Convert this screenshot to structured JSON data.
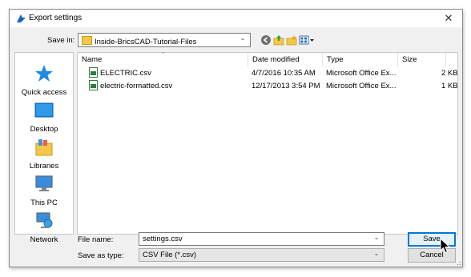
{
  "window": {
    "title": "Export settings",
    "close_glyph": "✕"
  },
  "save_in": {
    "label": "Save in:",
    "value": "Inside-BricsCAD-Tutorial-Files"
  },
  "toolbar": {
    "icons": [
      "back-icon",
      "up-folder-icon",
      "new-folder-icon",
      "view-menu-icon"
    ]
  },
  "places": [
    {
      "label": "Quick access",
      "icon": "star-icon"
    },
    {
      "label": "Desktop",
      "icon": "desktop-icon"
    },
    {
      "label": "Libraries",
      "icon": "libraries-icon"
    },
    {
      "label": "This PC",
      "icon": "computer-icon"
    },
    {
      "label": "Network",
      "icon": "network-icon"
    }
  ],
  "columns": {
    "name": "Name",
    "date": "Date modified",
    "type": "Type",
    "size": "Size"
  },
  "files": [
    {
      "name": "ELECTRIC.csv",
      "date": "4/7/2016 10:35 AM",
      "type": "Microsoft Office Ex...",
      "size": "2 KB"
    },
    {
      "name": "electric-formatted.csv",
      "date": "12/17/2013 3:54 PM",
      "type": "Microsoft Office Ex...",
      "size": "1 KB"
    }
  ],
  "file_name": {
    "label": "File name:",
    "value": "settings.csv"
  },
  "save_as_type": {
    "label": "Save as type:",
    "value": "CSV File (*.csv)"
  },
  "buttons": {
    "save": "Save",
    "cancel": "Cancel"
  },
  "colors": {
    "accent": "#0078d7",
    "star": "#1e88e5",
    "folder": "#f3c84a",
    "csv_icon": "#2f7d3a"
  }
}
